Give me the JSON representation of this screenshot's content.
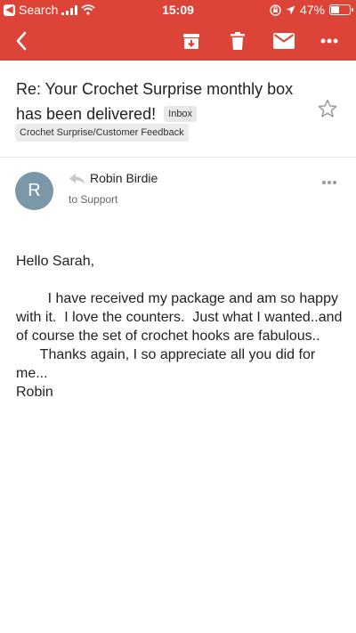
{
  "status_bar": {
    "back_app": "Search",
    "time": "15:09",
    "battery": "47%",
    "battery_level": 0.47
  },
  "toolbar": {
    "back_icon": "chevron-left-icon",
    "archive_icon": "archive-icon",
    "delete_icon": "trash-icon",
    "mark_unread_icon": "mail-icon",
    "more_icon": "more-horizontal-icon"
  },
  "email": {
    "subject_line1": "Re: Your Crochet Surprise monthly box",
    "subject_line2": "has been delivered!",
    "inbox_badge": "Inbox",
    "label_chip": "Crochet Surprise/Customer Feedback",
    "sender_initial": "R",
    "sender_name": "Robin Birdie",
    "recipient": "to Support",
    "body": "Hello Sarah,\n\n        I have received my package and am so happy with it.  I love the counters.  Just what I wanted..and of course the set of crochet hooks are fabulous..\n      Thanks again, I so appreciate all you did for me...\nRobin"
  },
  "colors": {
    "header": "#db4437",
    "avatar": "#7a98a8"
  }
}
